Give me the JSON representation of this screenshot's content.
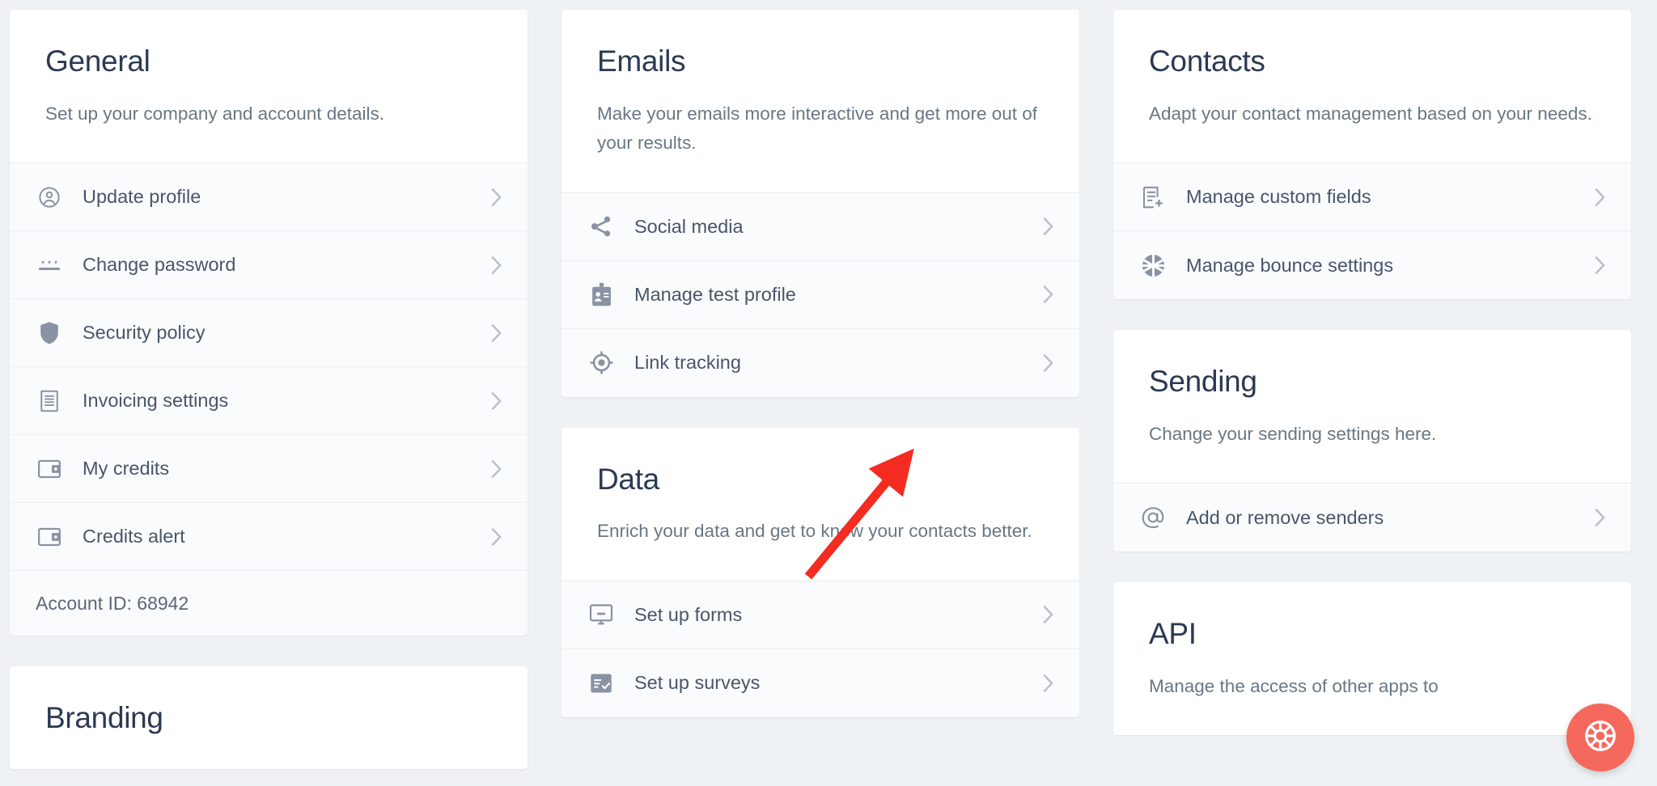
{
  "theme": {
    "page_background": "#eff2f4",
    "card_background": "#ffffff",
    "row_background": "#fafbfc",
    "title_color": "#2b3a53",
    "description_color": "#6b7684",
    "row_label_color": "#49556b",
    "icon_color": "#8a93a3",
    "chevron_color": "#b9c0cb",
    "annotation_arrow_color": "#f42b20",
    "support_bubble_color": "#f4695c"
  },
  "columns": [
    {
      "cards": [
        {
          "title": "General",
          "description": "Set up your company and account details.",
          "rows": [
            {
              "icon": "user-circle-icon",
              "label": "Update profile",
              "chevron": true
            },
            {
              "icon": "password-dots-icon",
              "label": "Change password",
              "chevron": true
            },
            {
              "icon": "shield-icon",
              "label": "Security policy",
              "chevron": true
            },
            {
              "icon": "invoice-icon",
              "label": "Invoicing settings",
              "chevron": true
            },
            {
              "icon": "wallet-icon",
              "label": "My credits",
              "chevron": true
            },
            {
              "icon": "wallet-icon",
              "label": "Credits alert",
              "chevron": true
            }
          ],
          "footer": "Account ID: 68942"
        },
        {
          "title": "Branding",
          "description": "",
          "rows": []
        }
      ]
    },
    {
      "cards": [
        {
          "title": "Emails",
          "description": "Make your emails more interactive and get more out of your results.",
          "rows": [
            {
              "icon": "share-icon",
              "label": "Social media",
              "chevron": true
            },
            {
              "icon": "id-badge-icon",
              "label": "Manage test profile",
              "chevron": true
            },
            {
              "icon": "target-icon",
              "label": "Link tracking",
              "chevron": true
            }
          ]
        },
        {
          "title": "Data",
          "description": "Enrich your data and get to know your contacts better.",
          "rows": [
            {
              "icon": "form-icon",
              "label": "Set up forms",
              "chevron": true
            },
            {
              "icon": "survey-icon",
              "label": "Set up surveys",
              "chevron": true
            }
          ]
        }
      ]
    },
    {
      "cards": [
        {
          "title": "Contacts",
          "description": "Adapt your contact management based on your needs.",
          "rows": [
            {
              "icon": "custom-fields-icon",
              "label": "Manage custom fields",
              "chevron": true
            },
            {
              "icon": "bounce-ball-icon",
              "label": "Manage bounce settings",
              "chevron": true
            }
          ]
        },
        {
          "title": "Sending",
          "description": "Change your sending settings here.",
          "rows": [
            {
              "icon": "at-sign-icon",
              "label": "Add or remove senders",
              "chevron": true
            }
          ]
        },
        {
          "title": "API",
          "description": "Manage the access of other apps to",
          "rows": []
        }
      ]
    }
  ],
  "annotation": {
    "type": "arrow",
    "points_to": "Add or remove senders"
  },
  "support": {
    "icon": "lifebuoy-icon",
    "label": "Support"
  }
}
